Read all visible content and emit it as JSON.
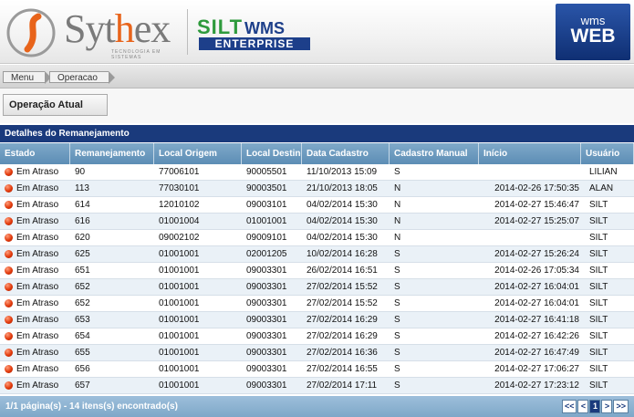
{
  "header": {
    "sythex_word_start": "Syt",
    "sythex_word_accent": "h",
    "sythex_word_end": "ex",
    "sythex_tagline": "TECNOLOGIA EM SISTEMAS",
    "silt_top": "SILT",
    "silt_wms": "WMS",
    "silt_enterprise": "ENTERPRISE",
    "wmsweb_small": "wms",
    "wmsweb_big": "WEB"
  },
  "breadcrumb": [
    "Menu",
    "Operacao"
  ],
  "operation_button": "Operação Atual",
  "section_title": "Detalhes do Remanejamento",
  "table": {
    "columns": [
      "Estado",
      "Remanejamento",
      "Local Origem",
      "Local Destino",
      "Data Cadastro",
      "Cadastro Manual",
      "Início",
      "Usuário"
    ],
    "rows": [
      [
        "Em Atraso",
        "90",
        "77006101",
        "90005501",
        "11/10/2013 15:09",
        "S",
        "",
        "LILIAN"
      ],
      [
        "Em Atraso",
        "113",
        "77030101",
        "90003501",
        "21/10/2013 18:05",
        "N",
        "2014-02-26 17:50:35",
        "ALAN"
      ],
      [
        "Em Atraso",
        "614",
        "12010102",
        "09003101",
        "04/02/2014 15:30",
        "N",
        "2014-02-27 15:46:47",
        "SILT"
      ],
      [
        "Em Atraso",
        "616",
        "01001004",
        "01001001",
        "04/02/2014 15:30",
        "N",
        "2014-02-27 15:25:07",
        "SILT"
      ],
      [
        "Em Atraso",
        "620",
        "09002102",
        "09009101",
        "04/02/2014 15:30",
        "N",
        "",
        "SILT"
      ],
      [
        "Em Atraso",
        "625",
        "01001001",
        "02001205",
        "10/02/2014 16:28",
        "S",
        "2014-02-27 15:26:24",
        "SILT"
      ],
      [
        "Em Atraso",
        "651",
        "01001001",
        "09003301",
        "26/02/2014 16:51",
        "S",
        "2014-02-26 17:05:34",
        "SILT"
      ],
      [
        "Em Atraso",
        "652",
        "01001001",
        "09003301",
        "27/02/2014 15:52",
        "S",
        "2014-02-27 16:04:01",
        "SILT"
      ],
      [
        "Em Atraso",
        "652",
        "01001001",
        "09003301",
        "27/02/2014 15:52",
        "S",
        "2014-02-27 16:04:01",
        "SILT"
      ],
      [
        "Em Atraso",
        "653",
        "01001001",
        "09003301",
        "27/02/2014 16:29",
        "S",
        "2014-02-27 16:41:18",
        "SILT"
      ],
      [
        "Em Atraso",
        "654",
        "01001001",
        "09003301",
        "27/02/2014 16:29",
        "S",
        "2014-02-27 16:42:26",
        "SILT"
      ],
      [
        "Em Atraso",
        "655",
        "01001001",
        "09003301",
        "27/02/2014 16:36",
        "S",
        "2014-02-27 16:47:49",
        "SILT"
      ],
      [
        "Em Atraso",
        "656",
        "01001001",
        "09003301",
        "27/02/2014 16:55",
        "S",
        "2014-02-27 17:06:27",
        "SILT"
      ],
      [
        "Em Atraso",
        "657",
        "01001001",
        "09003301",
        "27/02/2014 17:11",
        "S",
        "2014-02-27 17:23:12",
        "SILT"
      ]
    ]
  },
  "footer": {
    "summary": "1/1 página(s) - 14 itens(s) encontrado(s)",
    "pager": [
      "<<",
      "<",
      "1",
      ">",
      ">>"
    ],
    "current_page": "1"
  },
  "colors": {
    "section_header": "#1a3a7c",
    "table_header": "#6b98bf",
    "status_dot": "#e23a0c",
    "sythex_accent": "#e8641b",
    "silt_green": "#2e9a3c"
  },
  "icons": {
    "status": "red-dot-icon",
    "sythex": "sythex-swoosh-icon"
  }
}
